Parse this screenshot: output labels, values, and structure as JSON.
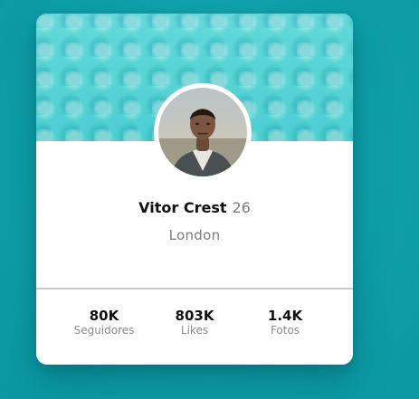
{
  "profile": {
    "name": "Vitor Crest",
    "age": "26",
    "city": "London"
  },
  "stats": [
    {
      "value": "80K",
      "label": "Seguidores"
    },
    {
      "value": "803K",
      "label": "Likes"
    },
    {
      "value": "1.4K",
      "label": "Fotos"
    }
  ],
  "colors": {
    "background": "#0fa3ad",
    "banner": "#5fd6d8",
    "card": "#ffffff",
    "divider": "#c9cbcd"
  }
}
